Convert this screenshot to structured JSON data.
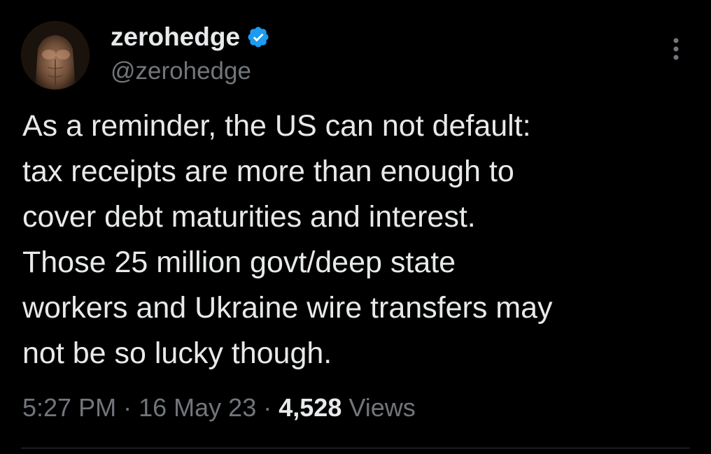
{
  "author": {
    "display_name": "zerohedge",
    "handle": "@zerohedge",
    "verified": true,
    "verified_color": "#1d9bf0"
  },
  "tweet": {
    "text": "As a reminder, the US can not default:\ntax receipts are more than enough to\ncover debt maturities and interest.\nThose 25 million govt/deep state\nworkers and Ukraine wire transfers may\nnot be so lucky though.",
    "time": "5:27 PM",
    "date": "16 May 23",
    "separator": "·",
    "views_count": "4,528",
    "views_label": "Views"
  },
  "icons": {
    "avatar": "avatar",
    "verified": "verified-badge-icon",
    "more": "more-options-icon"
  },
  "colors": {
    "background": "#000000",
    "primary_text": "#e7e9ea",
    "secondary_text": "#71767b",
    "divider": "#2f3336"
  }
}
